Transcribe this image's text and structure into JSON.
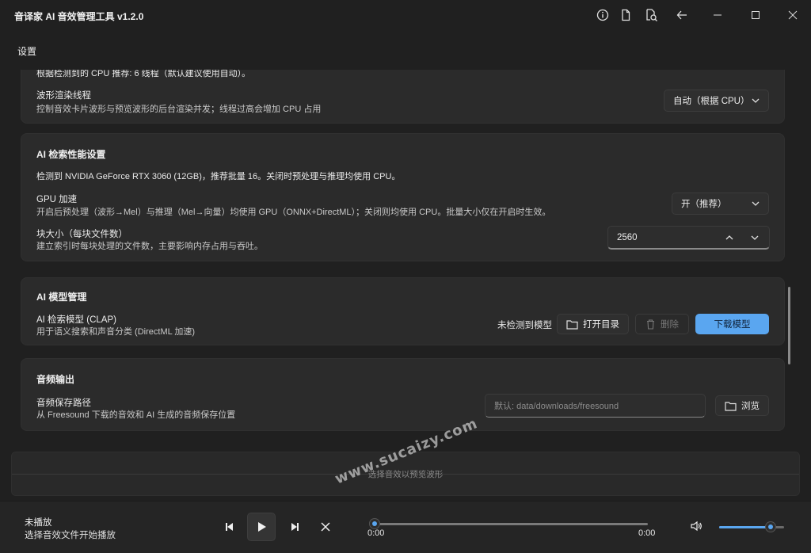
{
  "app": {
    "title": "音译家 AI 音效管理工具 v1.2.0"
  },
  "titlebar_icons": [
    "info-icon",
    "document-icon",
    "search-file-icon",
    "back-arrow-icon"
  ],
  "window_controls": [
    "minimize-icon",
    "maximize-icon",
    "close-icon"
  ],
  "page": {
    "title": "设置"
  },
  "cpu_card": {
    "partial_line": "根据检测到的 CPU 推荐: 6 线程（默认建议使用自动）。",
    "waveform_threads": {
      "label": "波形渲染线程",
      "desc": "控制音效卡片波形与预览波形的后台渲染并发；线程过高会增加 CPU 占用",
      "value": "自动（根据 CPU）"
    }
  },
  "ai_perf": {
    "title": "AI 检索性能设置",
    "detect_line": "检测到 NVIDIA GeForce RTX 3060 (12GB)，推荐批量 16。关闭时预处理与推理均使用 CPU。",
    "gpu": {
      "label": "GPU 加速",
      "desc": "开启后预处理（波形→Mel）与推理（Mel→向量）均使用 GPU（ONNX+DirectML）；关闭则均使用 CPU。批量大小仅在开启时生效。",
      "value": "开（推荐）"
    },
    "chunk": {
      "label": "块大小（每块文件数）",
      "desc": "建立索引时每块处理的文件数，主要影响内存占用与吞吐。",
      "value": "2560"
    }
  },
  "ai_model": {
    "title": "AI 模型管理",
    "model_label": "AI 检索模型 (CLAP)",
    "model_desc": "用于语义搜索和声音分类 (DirectML 加速)",
    "status": "未检测到模型",
    "open_dir": "打开目录",
    "delete": "删除",
    "download": "下载模型"
  },
  "audio_output": {
    "title": "音频输出",
    "path_label": "音频保存路径",
    "path_desc": "从 Freesound 下载的音效和 AI 生成的音频保存位置",
    "path_placeholder": "默认: data/downloads/freesound",
    "browse": "浏览"
  },
  "waveform_preview": {
    "hint": "选择音效以预览波形"
  },
  "player": {
    "title": "未播放",
    "subtitle": "选择音效文件开始播放",
    "time_current": "0:00",
    "time_total": "0:00",
    "progress": 0,
    "volume": 0.8
  },
  "watermark": "www.sucaizy.com",
  "colors": {
    "accent": "#5aa6f0",
    "background": "#202020",
    "card": "#2b2b2b"
  }
}
